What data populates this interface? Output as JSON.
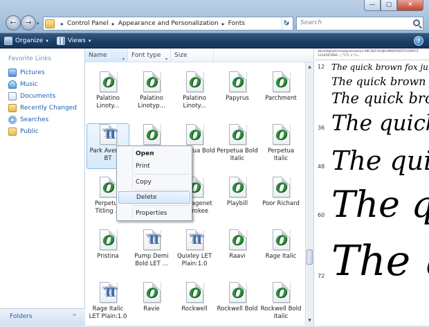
{
  "window": {
    "minimize": "—",
    "maximize": "▢",
    "close": "✕"
  },
  "nav": {
    "back": "←",
    "forward": "→",
    "history": "▾",
    "refresh": "↻"
  },
  "address": {
    "crumbs": [
      "Control Panel",
      "Appearance and Personalization",
      "Fonts"
    ],
    "sep": "▸",
    "dropdown": "▾"
  },
  "search": {
    "placeholder": "Search"
  },
  "toolbar": {
    "organize": "Organize",
    "views": "Views",
    "caret": "▾",
    "help": "?"
  },
  "sidebar": {
    "header": "Favorite Links",
    "items": [
      {
        "label": "Pictures"
      },
      {
        "label": "Music"
      },
      {
        "label": "Documents"
      },
      {
        "label": "Recently Changed"
      },
      {
        "label": "Searches"
      },
      {
        "label": "Public"
      }
    ],
    "folders": "Folders",
    "folders_caret": "^"
  },
  "columns": {
    "name": "Name",
    "font_type": "Font type",
    "size": "Size",
    "caret": "▾"
  },
  "fonts": [
    {
      "label": "Palatino Linoty...",
      "icon": "o"
    },
    {
      "label": "Palatino Linotyp...",
      "icon": "o"
    },
    {
      "label": "Palatino Linoty...",
      "icon": "o"
    },
    {
      "label": "Papyrus",
      "icon": "o"
    },
    {
      "label": "Parchment",
      "icon": "o"
    },
    {
      "label": "Park Avenue BT",
      "icon": "tt"
    },
    {
      "label": "",
      "icon": "o"
    },
    {
      "label": "Perpetua Bold",
      "icon": "o"
    },
    {
      "label": "Perpetua Bold Italic",
      "icon": "o"
    },
    {
      "label": "Perpetua Italic",
      "icon": "o"
    },
    {
      "label": "Perpetua Titling ...",
      "icon": "o"
    },
    {
      "label": "",
      "icon": "o"
    },
    {
      "label": "Plantagenet Cherokee",
      "icon": "o"
    },
    {
      "label": "Playbill",
      "icon": "o"
    },
    {
      "label": "Poor Richard",
      "icon": "o"
    },
    {
      "label": "Pristina",
      "icon": "o"
    },
    {
      "label": "Pump Demi Bold LET ...",
      "icon": "tt"
    },
    {
      "label": "Quixley LET Plain:1.0",
      "icon": "tt"
    },
    {
      "label": "Raavi",
      "icon": "o"
    },
    {
      "label": "Rage Italic",
      "icon": "o"
    },
    {
      "label": "Rage Italic LET Plain:1.0",
      "icon": "tt"
    },
    {
      "label": "Ravie",
      "icon": "o"
    },
    {
      "label": "Rockwell",
      "icon": "o"
    },
    {
      "label": "Rockwell Bold",
      "icon": "o"
    },
    {
      "label": "Rockwell Bold Italic",
      "icon": "o"
    }
  ],
  "context_menu": {
    "open": "Open",
    "print": "Print",
    "copy": "Copy",
    "delete": "Delete",
    "properties": "Properties"
  },
  "preview": {
    "header_line": "abcdefghijklmnopqrstuvwxyz ABCDEFGHIJKLMNOPQRSTUVWXYZ",
    "header_line2": "1234567890.:,;'\"(!?) +-*/=",
    "samples": [
      {
        "size": "12",
        "text": "The quick brown fox jumps over the lazy dog."
      },
      {
        "size": "",
        "text": "The quick brown fox jumps"
      },
      {
        "size": "",
        "text": "The quick brown f"
      },
      {
        "size": "36",
        "text": "The quick b"
      },
      {
        "size": "48",
        "text": "The quick"
      },
      {
        "size": "60",
        "text": "The qu"
      },
      {
        "size": "72",
        "text": "The q"
      }
    ]
  }
}
